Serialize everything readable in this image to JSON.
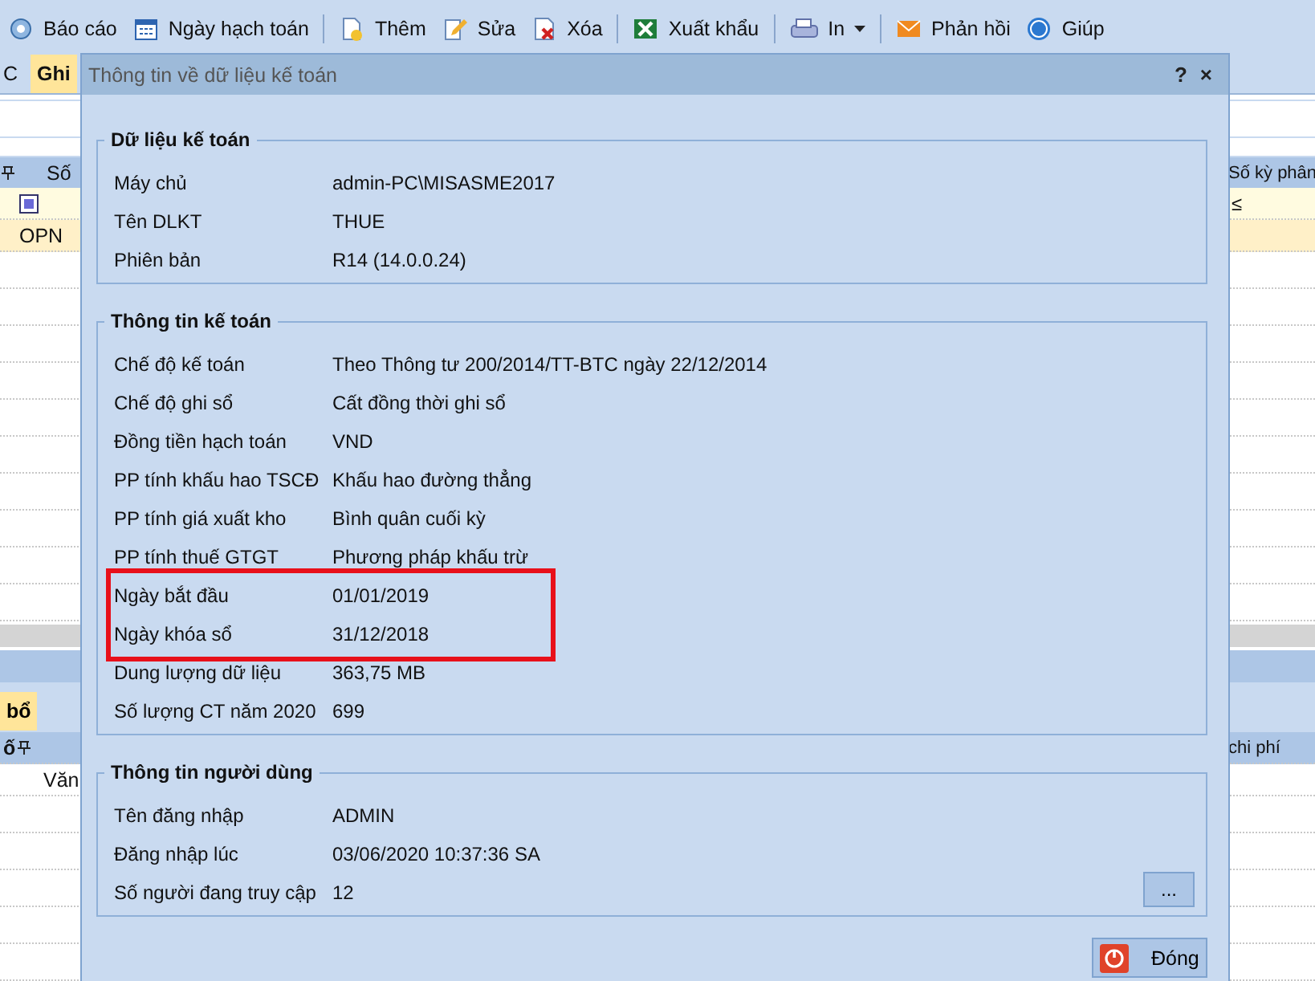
{
  "toolbar": [
    {
      "label": "Báo cáo",
      "group_start": false,
      "dropdown": false
    },
    {
      "label": "Ngày hạch toán",
      "group_start": false,
      "dropdown": false
    },
    {
      "label": "Thêm",
      "group_start": true,
      "dropdown": false
    },
    {
      "label": "Sửa",
      "group_start": false,
      "dropdown": false
    },
    {
      "label": "Xóa",
      "group_start": false,
      "dropdown": false
    },
    {
      "label": "Xuất khẩu",
      "group_start": true,
      "dropdown": false
    },
    {
      "label": "In",
      "group_start": true,
      "dropdown": true
    },
    {
      "label": "Phản hồi",
      "group_start": true,
      "dropdown": false
    },
    {
      "label": "Giúp",
      "group_start": false,
      "dropdown": false
    }
  ],
  "tabs": [
    {
      "label": "C",
      "selected": false
    },
    {
      "label": "Ghi",
      "selected": true
    }
  ],
  "grid": {
    "left_header": "Số",
    "right_header": "Số kỳ phân",
    "filter_operator": "≤",
    "rows": [
      "OPN"
    ]
  },
  "lower_tabs": [
    {
      "label": "bổ",
      "selected": true
    }
  ],
  "lower_grid": {
    "left_header": "ố",
    "right_header": "chi phí",
    "rows": [
      "Văn"
    ]
  },
  "dialog": {
    "title": "Thông tin về dữ liệu kế toán",
    "help": "?",
    "close": "×",
    "sections": [
      {
        "title": "Dữ liệu kế toán",
        "rows": [
          {
            "label": "Máy chủ",
            "value": "admin-PC\\MISASME2017",
            "highlighted": false
          },
          {
            "label": "Tên DLKT",
            "value": "THUE",
            "highlighted": false
          },
          {
            "label": "Phiên bản",
            "value": "R14 (14.0.0.24)",
            "highlighted": false
          }
        ]
      },
      {
        "title": "Thông tin kế toán",
        "rows": [
          {
            "label": "Chế độ kế toán",
            "value": "Theo Thông tư 200/2014/TT-BTC ngày 22/12/2014",
            "highlighted": false
          },
          {
            "label": "Chế độ ghi sổ",
            "value": "Cất đồng thời ghi sổ",
            "highlighted": false
          },
          {
            "label": "Đồng tiền hạch toán",
            "value": "VND",
            "highlighted": false
          },
          {
            "label": "PP tính khấu hao TSCĐ",
            "value": "Khấu hao đường thẳng",
            "highlighted": false
          },
          {
            "label": "PP tính giá xuất kho",
            "value": "Bình quân cuối kỳ",
            "highlighted": false
          },
          {
            "label": "PP tính thuế GTGT",
            "value": "Phương pháp khấu trừ",
            "highlighted": false
          },
          {
            "label": "Ngày bắt đầu",
            "value": "01/01/2019",
            "highlighted": true
          },
          {
            "label": "Ngày khóa sổ",
            "value": "31/12/2018",
            "highlighted": true
          },
          {
            "label": "Dung lượng dữ liệu",
            "value": "363,75 MB",
            "highlighted": false
          },
          {
            "label": "Số lượng CT năm 2020",
            "value": "699",
            "highlighted": false
          }
        ]
      },
      {
        "title": "Thông tin người dùng",
        "rows": [
          {
            "label": "Tên đăng nhập",
            "value": "ADMIN",
            "highlighted": false
          },
          {
            "label": "Đăng nhập lúc",
            "value": "03/06/2020 10:37:36 SA",
            "highlighted": false
          },
          {
            "label": "Số người đang truy cập",
            "value": "12",
            "highlighted": false
          }
        ],
        "button": "..."
      }
    ],
    "close_button": "Đóng"
  }
}
